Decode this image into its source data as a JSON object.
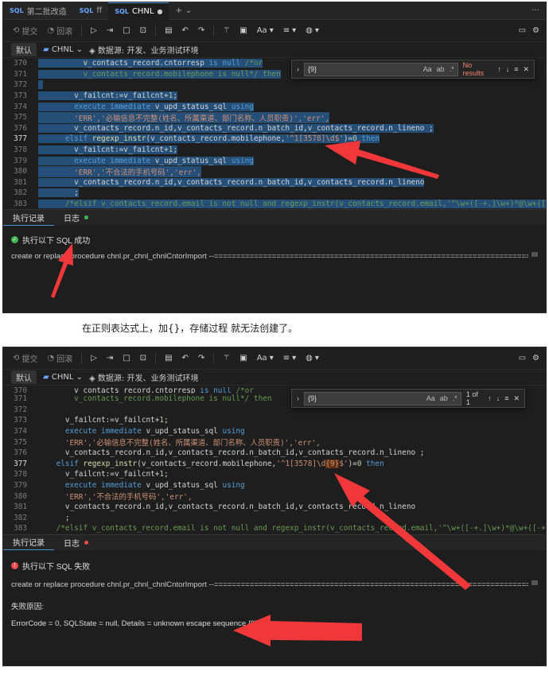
{
  "tabs": [
    {
      "icon": "SQL",
      "label": "第二批改造"
    },
    {
      "icon": "SQL",
      "label": "ff"
    },
    {
      "icon": "SQL",
      "label": "CHNL",
      "modified": "●"
    }
  ],
  "tab_plus": "+",
  "tab_more": "···",
  "toolbar": {
    "commit": "提交",
    "rollback": "回滚",
    "format_label": "Aa"
  },
  "context": {
    "default_label": "默认",
    "db": "CHNL",
    "datasource": "数据源: 开发、业务测试环境"
  },
  "screen1": {
    "lines": [
      {
        "n": "370",
        "text": "          v_contacts_record.cntorresp is null /*or"
      },
      {
        "n": "371",
        "text": "          v_contacts_record.mobilephone is null*/ then"
      },
      {
        "n": "372",
        "text": ""
      },
      {
        "n": "373",
        "text": "        v_failcnt:=v_failcnt+1;"
      },
      {
        "n": "374",
        "text": "        execute immediate v_upd_status_sql using"
      },
      {
        "n": "375",
        "text": "        'ERR','必输信息不完整(姓名、所属渠道、部门名称、人员职责)','err',"
      },
      {
        "n": "376",
        "text": "        v_contacts_record.n_id,v_contacts_record.n_batch_id,v_contacts_record.n_lineno ;"
      },
      {
        "n": "377",
        "text": "      elsif regexp_instr(v_contacts_record.mobilephone,'^1[3578]\\d$')=0 then"
      },
      {
        "n": "378",
        "text": "        v_failcnt:=v_failcnt+1;"
      },
      {
        "n": "379",
        "text": "        execute immediate v_upd_status_sql using"
      },
      {
        "n": "380",
        "text": "        'ERR','不合法的手机号码','err',"
      },
      {
        "n": "381",
        "text": "        v_contacts_record.n_id,v_contacts_record.n_batch_id,v_contacts_record.n_lineno"
      },
      {
        "n": "382",
        "text": "        ;"
      },
      {
        "n": "383",
        "text": "      /*elsif v_contacts_record.email is not null and regexp_instr(v_contacts_record.email,'^\\w+([-+.]\\w+)*@\\w+(["
      }
    ],
    "find": {
      "query": "{9}",
      "result": "No results"
    },
    "bottom_tabs": [
      "执行记录",
      "日志"
    ],
    "status": "执行以下 SQL 成功",
    "statement": "create or replace procedure chnl.pr_chnl_chnlCntorImport --==========================================================================="
  },
  "caption": "在正则表达式上，加{}，存储过程 就无法创建了。",
  "screen2": {
    "lines": [
      {
        "n": "370",
        "text": "        v_contacts_record.cntorresp is null /*or"
      },
      {
        "n": "371",
        "text": "        v_contacts_record.mobilephone is null*/ then"
      },
      {
        "n": "372",
        "text": ""
      },
      {
        "n": "373",
        "text": "      v_failcnt:=v_failcnt+1;"
      },
      {
        "n": "374",
        "text": "      execute immediate v_upd_status_sql using"
      },
      {
        "n": "375",
        "text": "      'ERR','必输信息不完整(姓名、所属渠道、部门名称、人员职责)','err',"
      },
      {
        "n": "376",
        "text": "      v_contacts_record.n_id,v_contacts_record.n_batch_id,v_contacts_record.n_lineno ;"
      },
      {
        "n": "377",
        "text": "    elsif regexp_instr(v_contacts_record.mobilephone,'^1[3578]\\d{9}$')=0 then"
      },
      {
        "n": "378",
        "text": "      v_failcnt:=v_failcnt+1;"
      },
      {
        "n": "379",
        "text": "      execute immediate v_upd_status_sql using"
      },
      {
        "n": "380",
        "text": "      'ERR','不合法的手机号码','err',"
      },
      {
        "n": "381",
        "text": "      v_contacts_record.n_id,v_contacts_record.n_batch_id,v_contacts_record.n_lineno"
      },
      {
        "n": "382",
        "text": "      ;"
      },
      {
        "n": "383",
        "text": "    /*elsif v_contacts_record.email is not null and regexp_instr(v_contacts_record.email,'^\\w+([-+.]\\w+)*@\\w+([-+."
      }
    ],
    "find": {
      "query": "{9}",
      "result": "1 of 1"
    },
    "bottom_tabs": [
      "执行记录",
      "日志"
    ],
    "status": "执行以下 SQL 失败",
    "statement": "create or replace procedure chnl.pr_chnl_chnlCntorImport --==========================================================================",
    "reason_label": "失败原因:",
    "error": "ErrorCode = 0, SQLState = null, Details = unknown escape sequence {9}"
  },
  "colors": {
    "accent": "#4d8fd6",
    "success": "#3fb950",
    "error": "#f14c4c",
    "arrow": "#f0383a"
  }
}
